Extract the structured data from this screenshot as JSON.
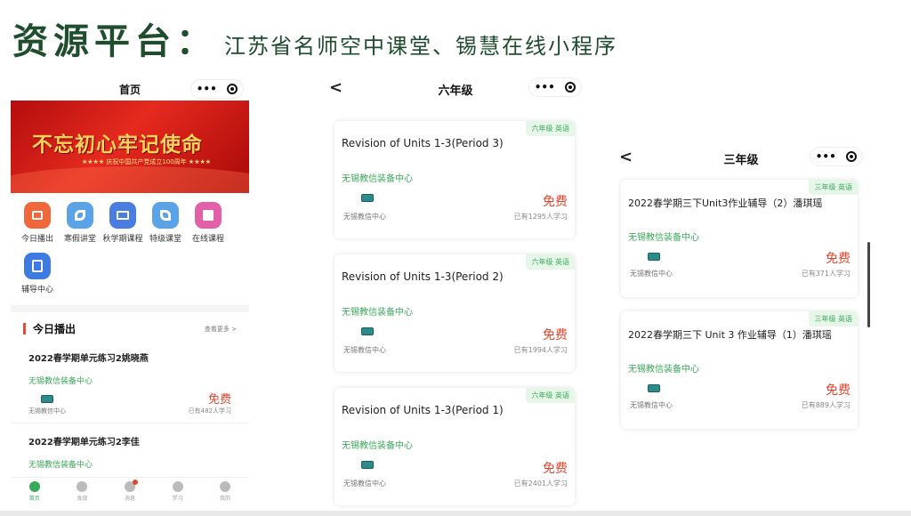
{
  "slide": {
    "title": "资源平台：",
    "subtitle": "江苏省名师空中课堂、锡慧在线小程序"
  },
  "phone_home": {
    "nav_title": "首页",
    "capsule_more": "•••",
    "banner": {
      "main": "不忘初心牢记使命",
      "sub": "★★★★ 庆祝中国共产党成立100周年 ★★★★"
    },
    "icons": [
      {
        "label": "今日播出",
        "color": "#f0673c"
      },
      {
        "label": "寒假讲堂",
        "color": "#5aa3e6"
      },
      {
        "label": "秋学期课程",
        "color": "#4a7de0"
      },
      {
        "label": "特级课堂",
        "color": "#5aa3e6"
      },
      {
        "label": "在线课程",
        "color": "#e260a8"
      },
      {
        "label": "辅导中心",
        "color": "#3d7be0"
      }
    ],
    "section": {
      "title": "今日播出",
      "more": "查看更多 >"
    },
    "courses": [
      {
        "title": "2022春学期单元练习2姚晓燕",
        "provider": "无锡教信装备中心",
        "org": "无锡教信中心",
        "price": "免费",
        "learners": "已有482人学习"
      },
      {
        "title": "2022春学期单元练习2李佳",
        "provider": "无锡教信装备中心"
      }
    ],
    "tabs": [
      {
        "label": "首页",
        "active": true
      },
      {
        "label": "发现",
        "active": false
      },
      {
        "label": "消息",
        "active": false
      },
      {
        "label": "学习",
        "active": false
      },
      {
        "label": "我的",
        "active": false
      }
    ]
  },
  "phone_grade6": {
    "nav_title": "六年级",
    "back": "<",
    "capsule_more": "•••",
    "cards": [
      {
        "tag": "六年级 英语",
        "title": "Revision of Units 1-3(Period 3)",
        "provider": "无锡教信装备中心",
        "org": "无锡教信中心",
        "price": "免费",
        "learners": "已有1295人学习"
      },
      {
        "tag": "六年级 英语",
        "title": "Revision of Units 1-3(Period 2)",
        "provider": "无锡教信装备中心",
        "org": "无锡教信中心",
        "price": "免费",
        "learners": "已有1994人学习"
      },
      {
        "tag": "六年级 英语",
        "title": "Revision of Units 1-3(Period 1)",
        "provider": "无锡教信装备中心",
        "org": "无锡教信中心",
        "price": "免费",
        "learners": "已有2401人学习"
      }
    ]
  },
  "phone_grade3": {
    "nav_title": "三年级",
    "back": "<",
    "capsule_more": "•••",
    "cards": [
      {
        "tag": "三年级 英语",
        "title": "2022春学期三下Unit3作业辅导（2）潘琪瑶",
        "provider": "无锡教信装备中心",
        "org": "无锡教信中心",
        "price": "免费",
        "learners": "已有371人学习"
      },
      {
        "tag": "三年级 英语",
        "title": "2022春学期三下 Unit 3 作业辅导（1）潘琪瑶",
        "provider": "无锡教信装备中心",
        "org": "无锡教信中心",
        "price": "免费",
        "learners": "已有889人学习"
      }
    ]
  }
}
